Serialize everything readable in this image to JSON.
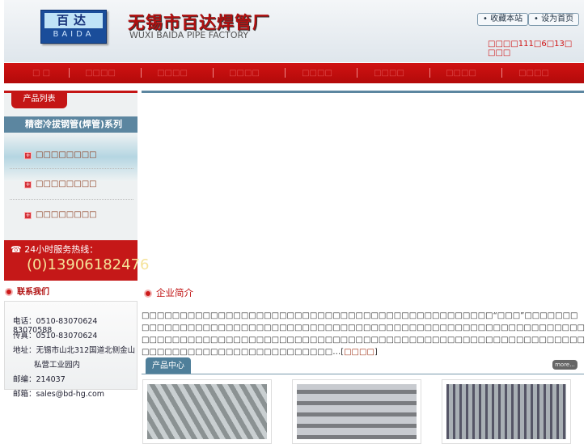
{
  "header": {
    "logo_cn": "百达",
    "logo_en": "BAIDA",
    "title_cn": "无锡市百达焊管厂",
    "title_en": "WUXI BAIDA PIPE FACTORY",
    "bookmark": "• 收藏本站",
    "homepage": "• 设为首页",
    "date": "□□□□111□6□13□ □□□"
  },
  "nav": [
    "□ □",
    "□□□□",
    "□□□□",
    "□□□□",
    "□□□□",
    "□□□□",
    "□□□□",
    "□□□□"
  ],
  "sidebar": {
    "tab": "产品列表",
    "category": "精密冷拔钢管(焊管)系列",
    "items": [
      "□□□□□□□□",
      "□□□□□□□□",
      "□□□□□□□□"
    ],
    "hotline_label": "24小时服务热线：",
    "hotline": "(0)13906182476"
  },
  "contact": {
    "title": "联系我们",
    "phone": "电话：0510-83070624 83070588",
    "fax": "传真：0510-83070624",
    "address1": "地址：无锡市山北312国道北侧金山",
    "address2": "私营工业园内",
    "zip": "邮编：214037",
    "email": "邮箱：sales@bd-hg.com"
  },
  "intro": {
    "title": "企业简介",
    "text": "□□□□□□□□□□□□□□□□□□□□□□□□□□□□□□□□□□□□□□□□□□□□□□“□□□”□□□□□□□□□□□□□□□□□□□□□□□□□□□□□□□□□□□□□□□□□□□□□□□□□□□□□□□□□□□□□□□□□□□□□□□□□□□□□□□□□□□□□□□□□□□□□□□□□□□□□□□□□□□□□□□□□□□□□□□□□□□□□□□□□□□□□□□□□□□□□□□□□□□□…[",
    "more": "□□□□",
    "close": "]"
  },
  "products": {
    "title": "产品中心",
    "more": "more..."
  }
}
